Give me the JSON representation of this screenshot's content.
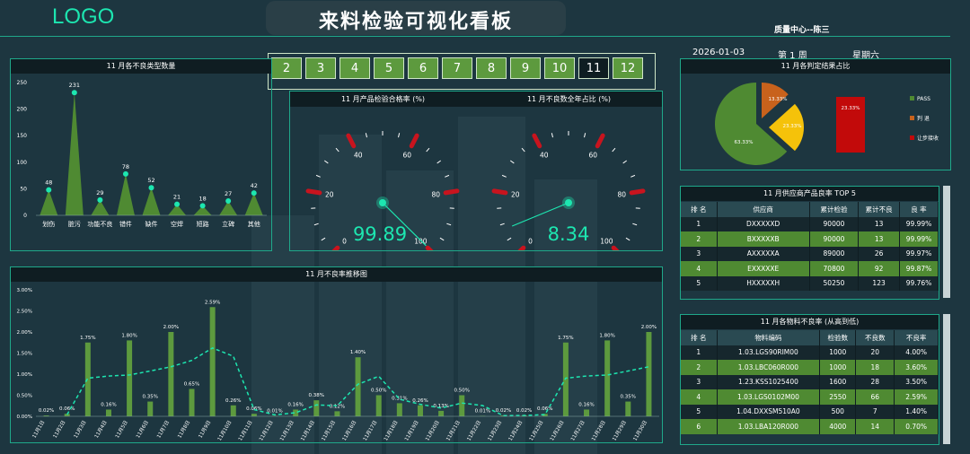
{
  "header": {
    "logo": "LOGO",
    "title": "来料检验可视化看板",
    "dept": "质量中心--陈三"
  },
  "months": {
    "items": [
      "2",
      "3",
      "4",
      "5",
      "6",
      "7",
      "8",
      "9",
      "10",
      "11",
      "12"
    ],
    "selected": "11"
  },
  "date": {
    "date": "2026-01-03",
    "week": "第 1 周",
    "weekday": "星期六"
  },
  "defect_types": {
    "title": "11 月各不良类型数量",
    "chart_data": {
      "type": "area",
      "categories": [
        "划伤",
        "脏污",
        "功能不良",
        "错件",
        "缺件",
        "空焊",
        "短路",
        "立碑",
        "其他"
      ],
      "values": [
        48,
        231,
        29,
        78,
        52,
        21,
        18,
        27,
        42
      ],
      "ylim": [
        0,
        250
      ],
      "yticks": [
        0,
        50,
        100,
        150,
        200,
        250
      ],
      "color": "#4f8a32",
      "marker": "#1de6b0"
    }
  },
  "gauge1": {
    "title": "11 月产品检验合格率 (%)",
    "value": "99.89",
    "chart_data": {
      "type": "gauge",
      "min": 0,
      "max": 100,
      "value": 99.89,
      "ticks": [
        0,
        20,
        40,
        60,
        80,
        100
      ]
    }
  },
  "gauge2": {
    "title": "11 月不良数全年占比 (%)",
    "value": "8.34",
    "chart_data": {
      "type": "gauge",
      "min": 0,
      "max": 100,
      "value": 8.34,
      "ticks": [
        0,
        20,
        40,
        60,
        80,
        100
      ]
    }
  },
  "judgement": {
    "title": "11 月各判定结果占比",
    "chart_data": {
      "type": "pie",
      "slices": [
        {
          "name": "PASS",
          "value": 63.33,
          "label": "63.33%",
          "color": "#4f8a32"
        },
        {
          "name": "判 退",
          "value": 13.33,
          "label": "13.33%",
          "color": "#c8621c"
        },
        {
          "name": "",
          "value": 23.33,
          "label": "23.33%",
          "color": "#f5c20a"
        },
        {
          "name": "让步接收",
          "value": 23.33,
          "label": "23.33%",
          "color": "#c20a0a"
        }
      ]
    }
  },
  "suppliers": {
    "title": "11 月供应商产品良率 TOP 5",
    "headers": [
      "排 名",
      "供应商",
      "累计检验",
      "累计不良",
      "良 率"
    ],
    "rows": [
      [
        "1",
        "DXXXXXD",
        "90000",
        "13",
        "99.99%"
      ],
      [
        "2",
        "BXXXXXB",
        "90000",
        "13",
        "99.99%"
      ],
      [
        "3",
        "AXXXXXA",
        "89000",
        "26",
        "99.97%"
      ],
      [
        "4",
        "EXXXXXE",
        "70800",
        "92",
        "99.87%"
      ],
      [
        "5",
        "HXXXXXH",
        "50250",
        "123",
        "99.76%"
      ]
    ]
  },
  "materials": {
    "title": "11 月各物料不良率 (从高到低)",
    "headers": [
      "排 名",
      "物料编码",
      "检验数",
      "不良数",
      "不良率"
    ],
    "rows": [
      [
        "1",
        "1.03.LGS90RIM00",
        "1000",
        "20",
        "4.00%"
      ],
      [
        "2",
        "1.03.LBC060R000",
        "1000",
        "18",
        "3.60%"
      ],
      [
        "3",
        "1.23.KSS1025400",
        "1600",
        "28",
        "3.50%"
      ],
      [
        "4",
        "1.03.LGS0102M00",
        "2550",
        "66",
        "2.59%"
      ],
      [
        "5",
        "1.04.DXXSM510A0",
        "500",
        "7",
        "1.40%"
      ],
      [
        "6",
        "1.03.LBA120R000",
        "4000",
        "14",
        "0.70%"
      ]
    ]
  },
  "trend": {
    "title": "11 月不良率推移图",
    "chart_data": {
      "type": "bar",
      "categories": [
        "11月1日",
        "11月2日",
        "11月3日",
        "11月4日",
        "11月5日",
        "11月6日",
        "11月7日",
        "11月8日",
        "11月9日",
        "11月10日",
        "11月11日",
        "11月12日",
        "11月13日",
        "11月14日",
        "11月15日",
        "11月16日",
        "11月17日",
        "11月18日",
        "11月19日",
        "11月20日",
        "11月21日",
        "11月22日",
        "11月23日",
        "11月24日",
        "11月25日",
        "11月26日",
        "11月27日",
        "11月28日",
        "11月29日",
        "11月30日"
      ],
      "values": [
        0.02,
        0.06,
        1.75,
        0.16,
        1.8,
        0.35,
        2.0,
        0.65,
        2.59,
        0.26,
        0.06,
        0.01,
        0.16,
        0.38,
        0.12,
        1.4,
        0.5,
        0.31,
        0.26,
        0.13,
        0.5,
        0.01,
        0.02,
        0.02,
        0.06,
        1.75,
        0.16,
        1.8,
        0.35,
        2.0
      ],
      "labels": [
        "0.02%",
        "0.06%",
        "1.75%",
        "0.16%",
        "1.80%",
        "0.35%",
        "2.00%",
        "0.65%",
        "2.59%",
        "0.26%",
        "0.06%",
        "0.01%",
        "0.16%",
        "0.38%",
        "0.12%",
        "1.40%",
        "0.50%",
        "0.31%",
        "0.26%",
        "0.13%",
        "0.50%",
        "0.01%",
        "0.02%",
        "0.02%",
        "0.06%",
        "1.75%",
        "0.16%",
        "1.80%",
        "0.35%",
        "2.00%"
      ],
      "trendline": "moving-average",
      "ylim": [
        0,
        3
      ],
      "yticks": [
        "0.00%",
        "0.50%",
        "1.00%",
        "1.50%",
        "2.00%",
        "2.50%",
        "3.00%"
      ],
      "bar_color": "#5d9a3e",
      "line_color": "#1de6b0"
    }
  }
}
